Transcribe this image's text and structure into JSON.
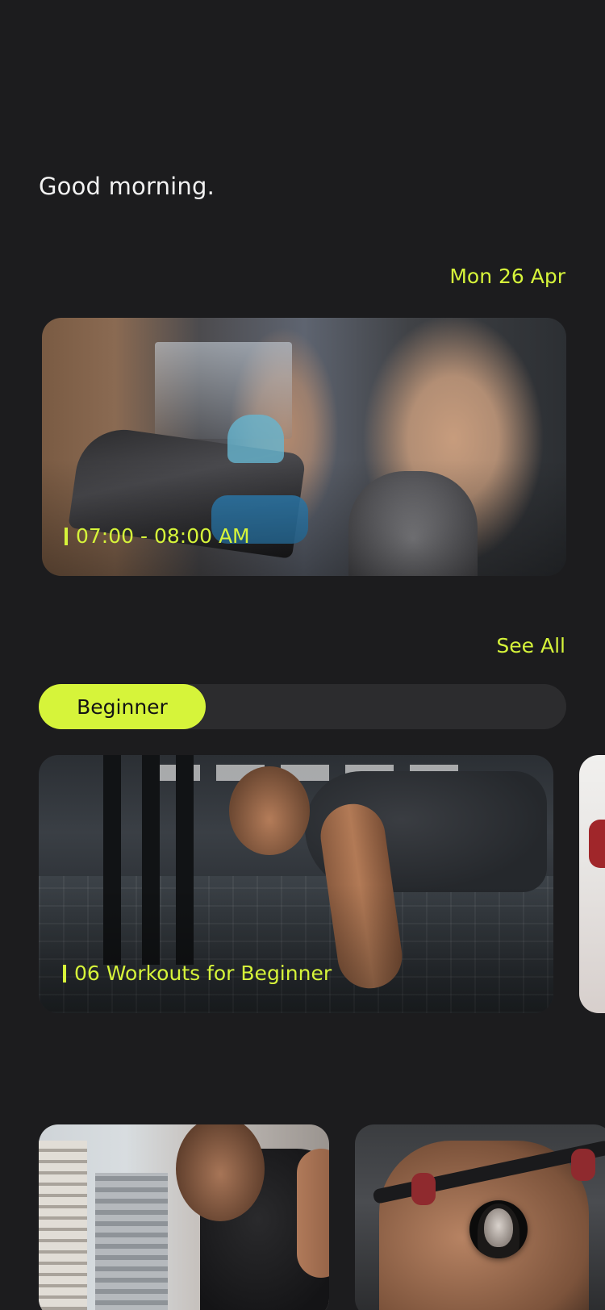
{
  "header": {
    "greeting": "Good morning.",
    "date": "Mon 26 Apr"
  },
  "featured_session": {
    "time": "07:00 - 08:00 AM"
  },
  "workouts_section": {
    "see_all_label": "See All",
    "selected_level": "Beginner",
    "card_caption": "06 Workouts  for Beginner"
  },
  "colors": {
    "accent": "#d6f43a",
    "background": "#1c1c1e",
    "track": "#2c2c2e"
  }
}
